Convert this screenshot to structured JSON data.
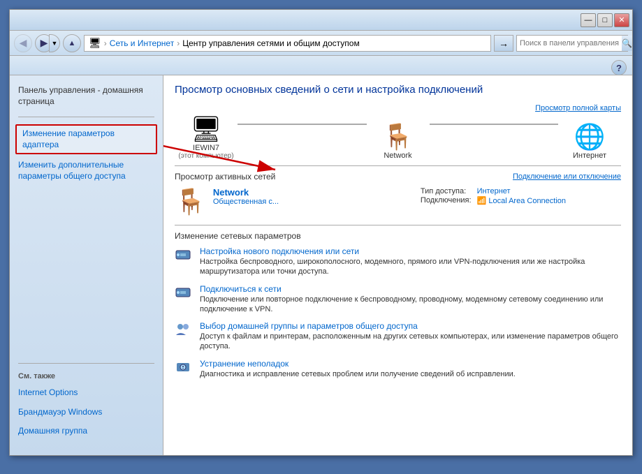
{
  "window": {
    "title_bar_buttons": {
      "minimize": "—",
      "maximize": "□",
      "close": "✕"
    }
  },
  "address_bar": {
    "back_icon": "◀",
    "forward_icon": "▶",
    "dropdown_icon": "▼",
    "path_icon": "🖥",
    "path_parts": [
      {
        "label": "Сеть и Интернет",
        "is_link": true
      },
      {
        "label": "Центр управления сетями и общим доступом",
        "is_link": false
      }
    ],
    "separator": " › ",
    "go_icon": "→",
    "search_placeholder": "Поиск в панели управления",
    "search_icon": "🔍"
  },
  "help_button": "?",
  "sidebar": {
    "home_label": "Панель управления - домашняя страница",
    "nav_items": [
      {
        "label": "Изменение параметров адаптера",
        "highlighted": true
      },
      {
        "label": "Изменить дополнительные параметры общего доступа"
      }
    ],
    "also_label": "См. также",
    "also_items": [
      {
        "label": "Internet Options"
      },
      {
        "label": "Брандмауэр Windows"
      },
      {
        "label": "Домашняя группа"
      }
    ]
  },
  "content": {
    "title": "Просмотр основных сведений о сети и настройка подключений",
    "view_full_map_link": "Просмотр полной карты",
    "network_nodes": [
      {
        "icon": "🖥",
        "label": "IEWIN7",
        "sublabel": "(этот компьютер)"
      },
      {
        "icon": "🪑",
        "label": "Network",
        "sublabel": ""
      },
      {
        "icon": "🌐",
        "label": "Интернет",
        "sublabel": ""
      }
    ],
    "active_networks_label": "Просмотр активных сетей",
    "connect_disconnect_label": "Подключение или отключение",
    "active_network": {
      "name": "Network",
      "type": "Общественная с...",
      "access_type_label": "Тип доступа:",
      "access_type_value": "Интернет",
      "connections_label": "Подключения:",
      "connections_value": "Local Area Connection",
      "connection_icon": "📶"
    },
    "change_network_label": "Изменение сетевых параметров",
    "settings": [
      {
        "link": "Настройка нового подключения или сети",
        "desc": "Настройка беспроводного, широкополосного, модемного, прямого или VPN-подключения или же настройка маршрутизатора или точки доступа.",
        "icon": "🔧"
      },
      {
        "link": "Подключиться к сети",
        "desc": "Подключение или повторное подключение к беспроводному, проводному, модемному сетевому соединению или подключение к VPN.",
        "icon": "🔧"
      },
      {
        "link": "Выбор домашней группы и параметров общего доступа",
        "desc": "Доступ к файлам и принтерам, расположенным на других сетевых компьютерах, или изменение параметров общего доступа.",
        "icon": "👥"
      },
      {
        "link": "Устранение неполадок",
        "desc": "Диагностика и исправление сетевых проблем или получение сведений об исправлении.",
        "icon": "🔧"
      }
    ]
  }
}
